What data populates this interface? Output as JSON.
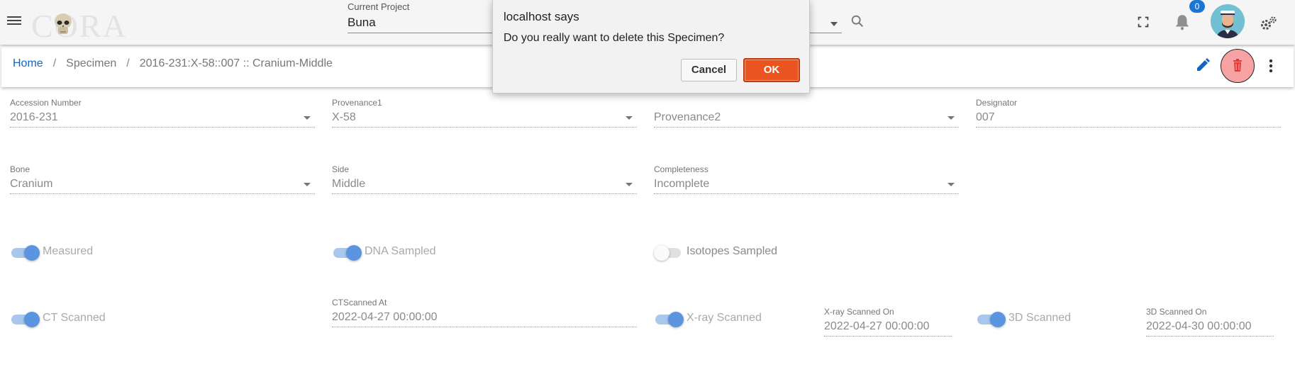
{
  "header": {
    "logo_text": "CORA",
    "project_label": "Current Project",
    "project_value": "Buna",
    "notification_count": "0"
  },
  "breadcrumb": {
    "home": "Home",
    "section": "Specimen",
    "current": "2016-231:X-58::007 :: Cranium-Middle"
  },
  "form": {
    "accession": {
      "label": "Accession Number",
      "value": "2016-231"
    },
    "provenance1": {
      "label": "Provenance1",
      "value": "X-58"
    },
    "provenance2": {
      "label": "",
      "value": "Provenance2"
    },
    "designator": {
      "label": "Designator",
      "value": "007"
    },
    "bone": {
      "label": "Bone",
      "value": "Cranium"
    },
    "side": {
      "label": "Side",
      "value": "Middle"
    },
    "completeness": {
      "label": "Completeness",
      "value": "Incomplete"
    },
    "measured": {
      "label": "Measured",
      "checked": true
    },
    "dna_sampled": {
      "label": "DNA Sampled",
      "checked": true
    },
    "isotopes_sampled": {
      "label": "Isotopes Sampled",
      "checked": false
    },
    "ct_scanned": {
      "label": "CT Scanned",
      "checked": true
    },
    "ct_scanned_at": {
      "label": "CTScanned At",
      "value": "2022-04-27 00:00:00"
    },
    "xray_scanned": {
      "label": "X-ray Scanned",
      "checked": true
    },
    "xray_scanned_on": {
      "label": "X-ray Scanned On",
      "value": "2022-04-27 00:00:00"
    },
    "scanned_3d": {
      "label": "3D Scanned",
      "checked": true
    },
    "scanned_3d_on": {
      "label": "3D Scanned On",
      "value": "2022-04-30 00:00:00"
    }
  },
  "dialog": {
    "title": "localhost says",
    "message": "Do you really want to delete this Specimen?",
    "cancel_label": "Cancel",
    "ok_label": "OK"
  },
  "colors": {
    "accent": "#1976d2",
    "toggle_on": "#5b95e0",
    "delete_bg": "#f7a3a3",
    "ok_button": "#e95420"
  },
  "icons": [
    "menu-icon",
    "search-icon",
    "fullscreen-icon",
    "bell-icon",
    "settings-icon",
    "edit-icon",
    "trash-icon",
    "more-vert-icon"
  ]
}
